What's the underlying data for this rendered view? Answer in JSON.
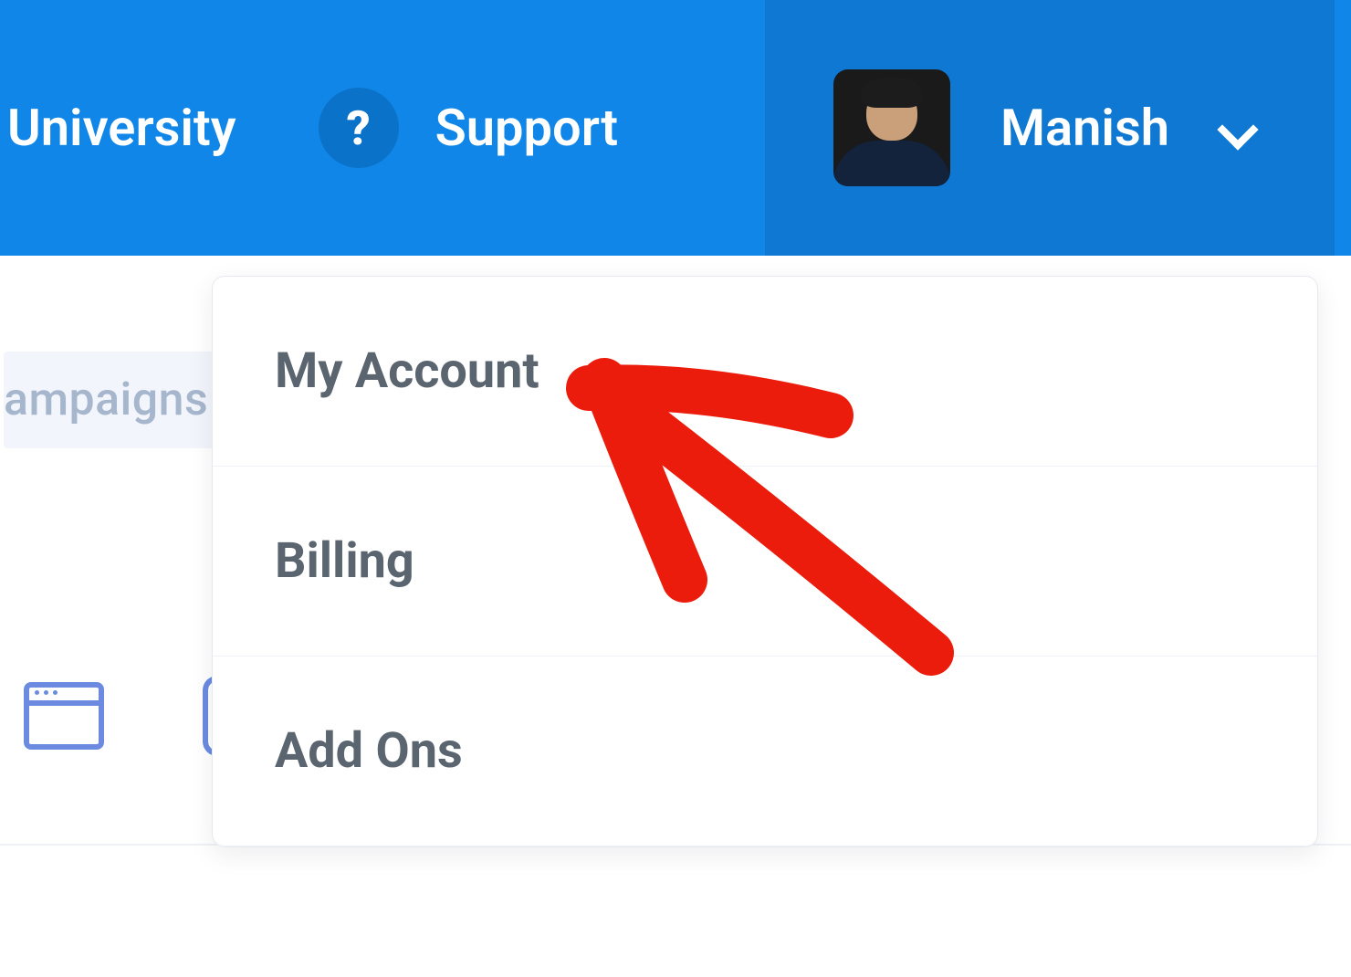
{
  "header": {
    "nav": {
      "university": "University",
      "support": "Support",
      "help_symbol": "?"
    },
    "user": {
      "name": "Manish"
    }
  },
  "page": {
    "partial_item": "ampaigns"
  },
  "dropdown": {
    "items": [
      {
        "label": "My Account"
      },
      {
        "label": "Billing"
      },
      {
        "label": "Add Ons"
      }
    ]
  },
  "colors": {
    "header_bg": "#0f86e8",
    "user_bg": "#0e78d3",
    "text_white": "#ffffff",
    "dropdown_text": "#5a6570",
    "annotation": "#eb1c0c"
  }
}
